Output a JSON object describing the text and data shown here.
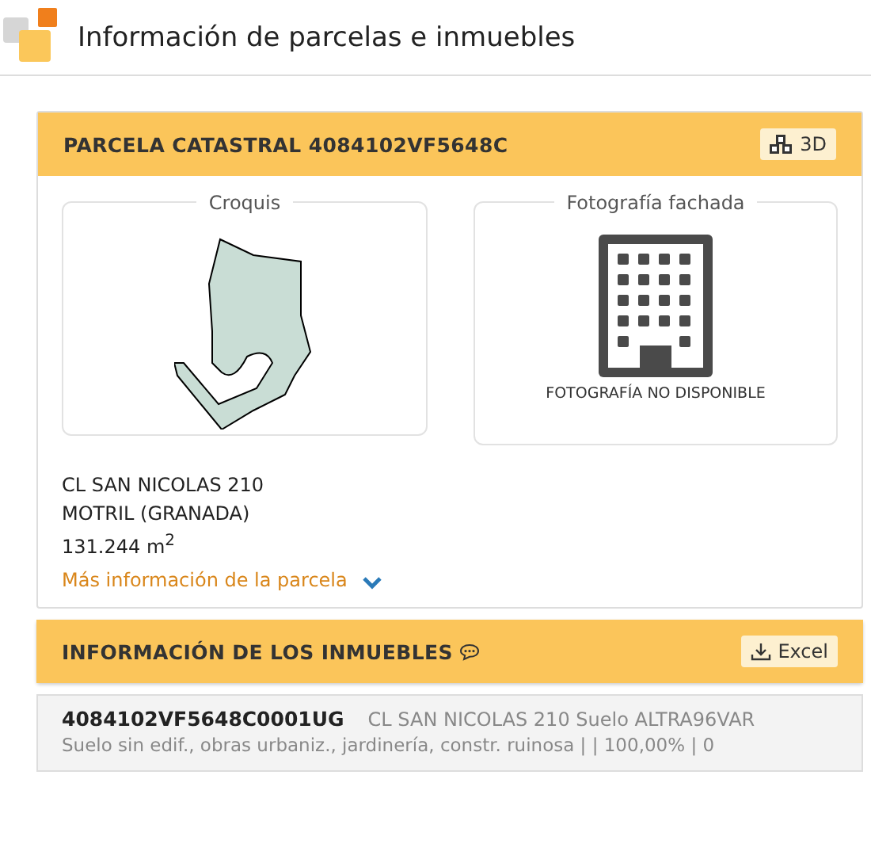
{
  "page_title": "Información de parcelas e inmuebles",
  "parcel": {
    "title": "PARCELA CATASTRAL 4084102VF5648C",
    "button_3d": "3D",
    "sketch": {
      "legend": "Croquis"
    },
    "photo": {
      "legend": "Fotografía fachada",
      "message": "FOTOGRAFÍA NO DISPONIBLE"
    },
    "address_lines": [
      "CL SAN NICOLAS 210",
      "MOTRIL (GRANADA)",
      "131.244 m$^{2}$"
    ],
    "more_link": "Más información de la parcela",
    "expanded": false
  },
  "properties": {
    "title": "INFORMACIÓN DE LOS INMUEBLES",
    "excel_button": "Excel",
    "items": [
      {
        "reference": "4084102VF5648C0001UG",
        "address": "CL SAN NICOLAS 210 Suelo ALTRA96VAR",
        "details": "Suelo sin edif., obras urbaniz., jardinería, constr. ruinosa | | 100,00% | 0"
      }
    ]
  }
}
